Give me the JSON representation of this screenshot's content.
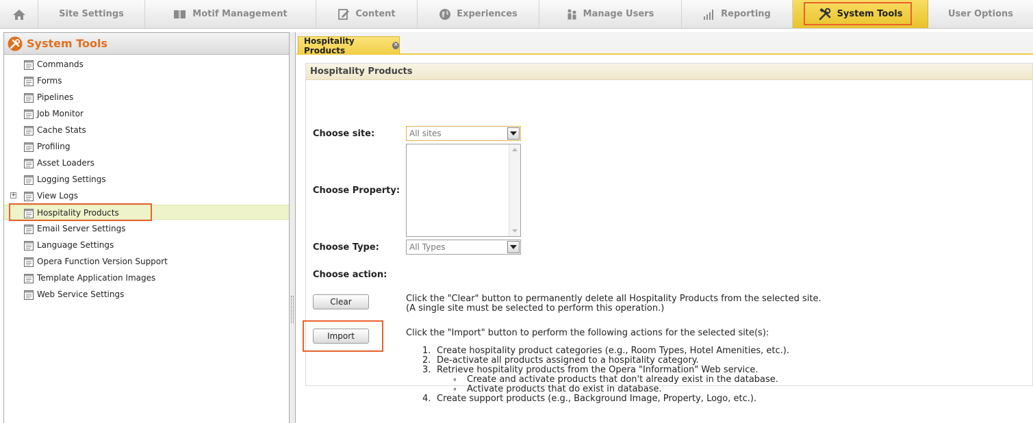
{
  "nav": {
    "home_icon": "home-icon",
    "items": [
      {
        "label": "Site Settings",
        "icon": ""
      },
      {
        "label": "Motif Management",
        "icon": "book-icon"
      },
      {
        "label": "Content",
        "icon": "edit-icon"
      },
      {
        "label": "Experiences",
        "icon": "globe-icon"
      },
      {
        "label": "Manage Users",
        "icon": "users-icon"
      },
      {
        "label": "Reporting",
        "icon": "bar-chart-icon"
      },
      {
        "label": "System Tools",
        "icon": "tools-icon",
        "active": true
      },
      {
        "label": "User Options",
        "icon": ""
      }
    ]
  },
  "sidebar": {
    "title": "System Tools",
    "items": [
      {
        "label": "Commands"
      },
      {
        "label": "Forms"
      },
      {
        "label": "Pipelines"
      },
      {
        "label": "Job Monitor"
      },
      {
        "label": "Cache Stats"
      },
      {
        "label": "Profiling"
      },
      {
        "label": "Asset Loaders"
      },
      {
        "label": "Logging Settings"
      },
      {
        "label": "View Logs",
        "expandable": true
      },
      {
        "label": "Hospitality Products",
        "selected": true
      },
      {
        "label": "Email Server Settings"
      },
      {
        "label": "Language Settings"
      },
      {
        "label": "Opera Function Version Support"
      },
      {
        "label": "Template Application Images"
      },
      {
        "label": "Web Service Settings"
      }
    ]
  },
  "tab": {
    "label": "Hospitality Products"
  },
  "section": {
    "title": "Hospitality Products"
  },
  "form": {
    "site_label": "Choose site:",
    "site_value": "All sites",
    "property_label": "Choose Property:",
    "type_label": "Choose Type:",
    "type_value": "All Types",
    "action_label": "Choose action:"
  },
  "actions": {
    "clear_button": "Clear",
    "clear_desc_1": "Click the \"Clear\" button to permanently delete all Hospitality Products from the selected site.",
    "clear_desc_2": "(A single site must be selected to perform this operation.)",
    "import_button": "Import",
    "import_desc": "Click the \"Import\" button to perform the following actions for the selected site(s):",
    "steps": [
      {
        "num": "1.",
        "text": "Create hospitality product categories (e.g., Room Types, Hotel Amenities, etc.)."
      },
      {
        "num": "2.",
        "text": "De-activate all products assigned to a hospitality category."
      },
      {
        "num": "3.",
        "text": "Retrieve hospitality products from the Opera \"Information\" Web service."
      },
      {
        "num": "∘",
        "text": "Create and activate products that don't already exist in the database.",
        "sub": true
      },
      {
        "num": "∘",
        "text": "Activate products that do exist in database.",
        "sub": true
      },
      {
        "num": "4.",
        "text": "Create support products (e.g., Background Image, Property, Logo, etc.)."
      }
    ]
  }
}
